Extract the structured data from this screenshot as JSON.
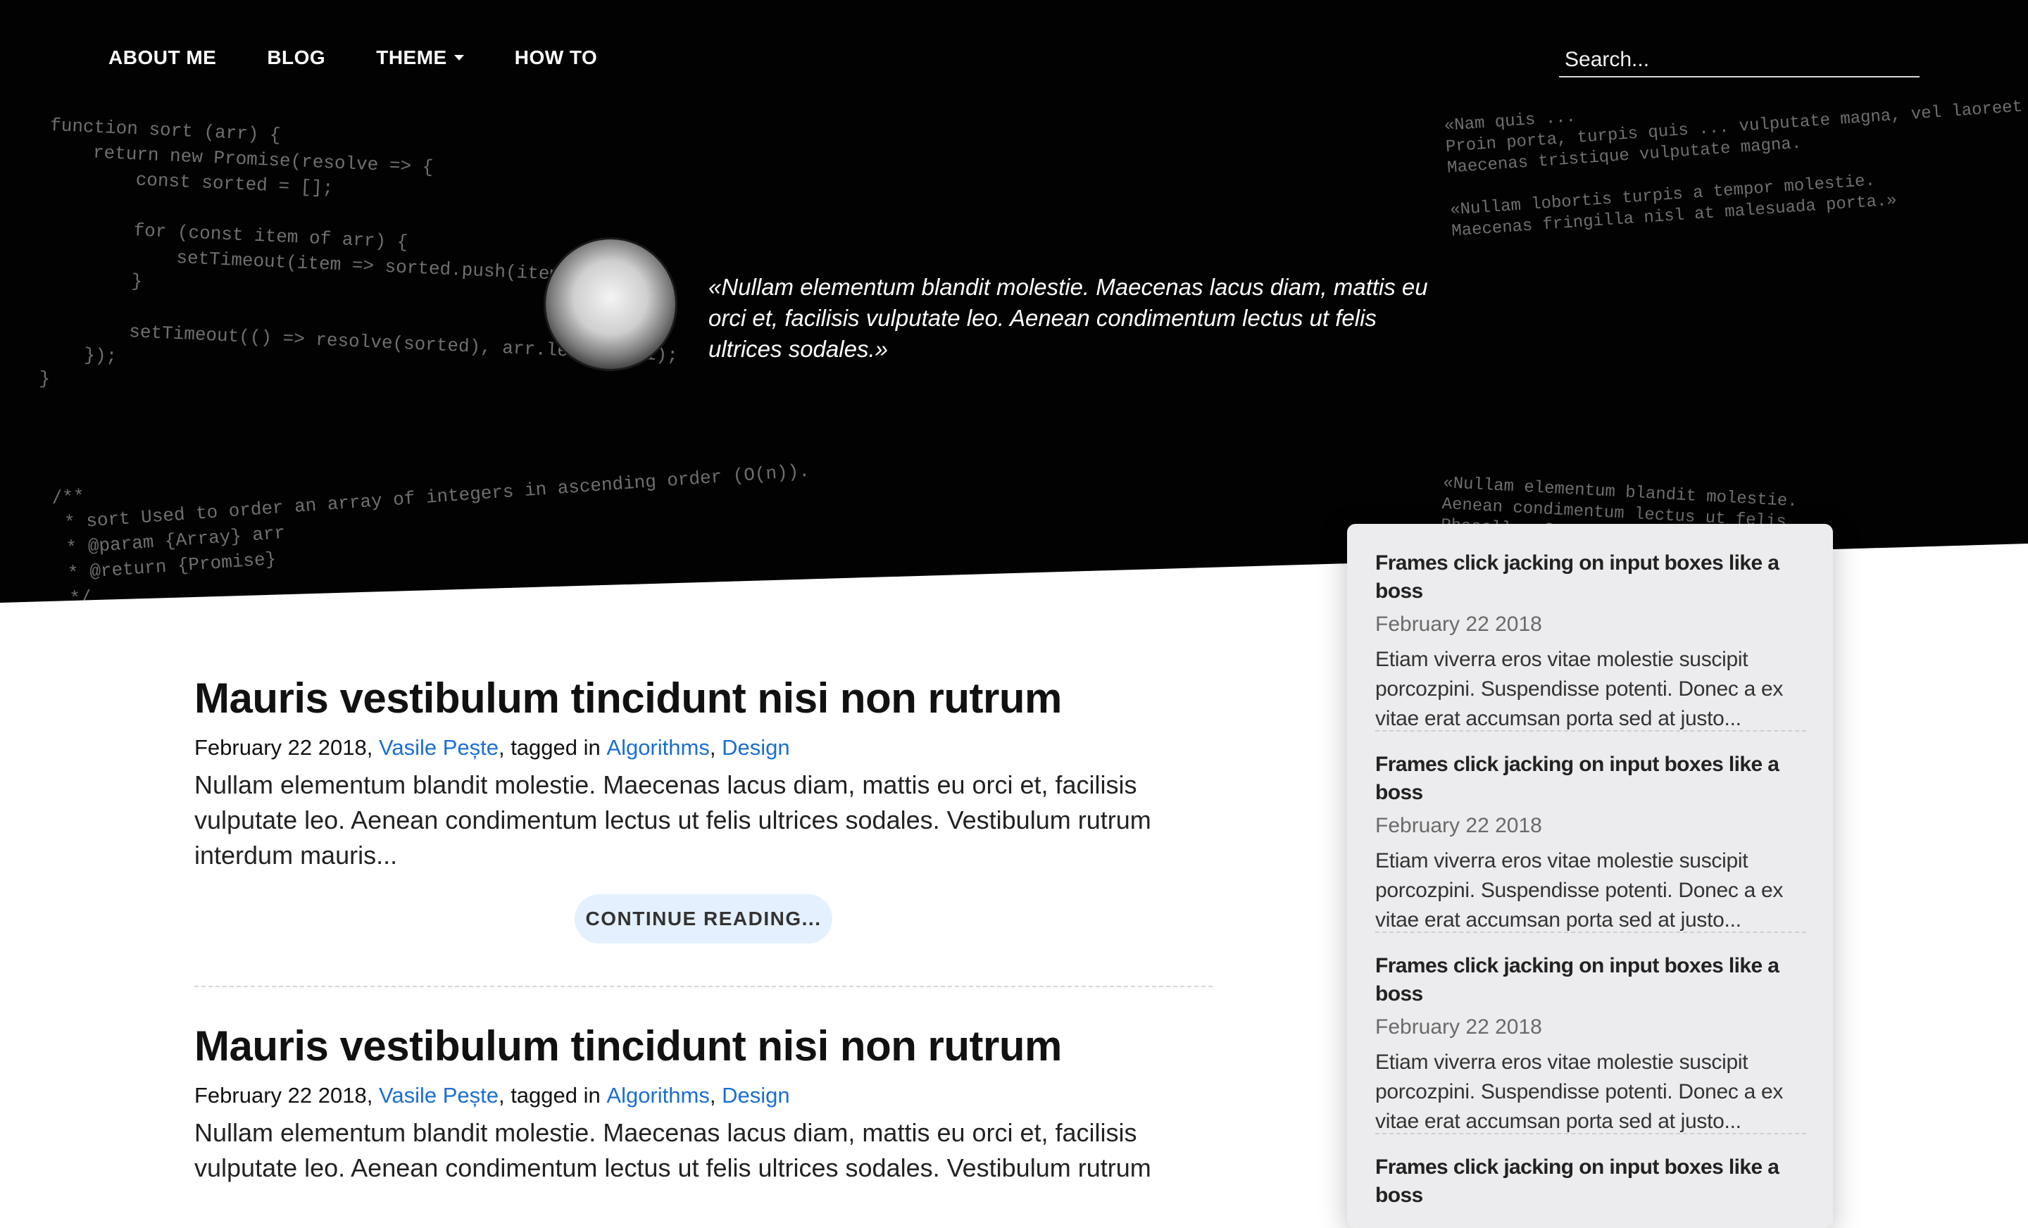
{
  "nav": {
    "items": [
      {
        "label": "ABOUT ME"
      },
      {
        "label": "BLOG"
      },
      {
        "label": "THEME"
      },
      {
        "label": "HOW TO"
      }
    ],
    "search_placeholder": "Search..."
  },
  "hero": {
    "code_left_top": "function sort (arr) {\n    return new Promise(resolve => {\n        const sorted = [];\n\n        for (const item of arr) {\n            setTimeout(item => sorted.push(item), item);\n        }\n\n        setTimeout(() => resolve(sorted), arr.length + 1);\n    });\n}",
    "code_left_bottom": "/**\n * sort Used to order an array of integers in ascending order (O(n)).\n * @param {Array} arr\n * @return {Promise}\n */",
    "code_right_top": "«Nam quis ...\nProin porta, turpis quis ... vulputate magna, vel laoreet\nMaecenas tristique vulputate magna.\n\n«Nullam lobortis turpis a tempor molestie.\nMaecenas fringilla nisl at malesuada porta.»",
    "code_right_bottom": "«Nullam elementum blandit molestie.\nAenean condimentum lectus ut felis\nPhasellus f...",
    "quote": "«Nullam elementum blandit molestie. Maecenas lacus diam, mattis eu orci et, facilisis vulputate leo. Aenean condimentum lectus ut felis ultrices sodales.»"
  },
  "posts": [
    {
      "title": "Mauris vestibulum tincidunt nisi non rutrum",
      "date": "February 22 2018,",
      "author": "Vasile Pește",
      "tagged": ", tagged in",
      "tag1": "Algorithms",
      "comma": ",",
      "tag2": "Design",
      "excerpt": "Nullam elementum blandit molestie. Maecenas lacus diam, mattis eu orci et, facilisis vulputate leo. Aenean condimentum lectus ut felis ultrices sodales. Vestibulum rutrum interdum mauris...",
      "read_more": "CONTINUE READING..."
    },
    {
      "title": "Mauris vestibulum tincidunt nisi non rutrum",
      "date": "February 22 2018,",
      "author": "Vasile Pește",
      "tagged": ", tagged in",
      "tag1": "Algorithms",
      "comma": ",",
      "tag2": "Design",
      "excerpt": "Nullam elementum blandit molestie. Maecenas lacus diam, mattis eu orci et, facilisis vulputate leo. Aenean condimentum lectus ut felis ultrices sodales. Vestibulum rutrum"
    }
  ],
  "sidebar": {
    "items": [
      {
        "title": "Frames click jacking on input boxes like a boss",
        "date": "February 22 2018",
        "text": "Etiam viverra eros vitae molestie suscipit porcozpini. Suspendisse potenti. Donec a ex vitae erat accumsan porta sed at justo..."
      },
      {
        "title": "Frames click jacking on input boxes like a boss",
        "date": "February 22 2018",
        "text": "Etiam viverra eros vitae molestie suscipit porcozpini. Suspendisse potenti. Donec a ex vitae erat accumsan porta sed at justo..."
      },
      {
        "title": "Frames click jacking on input boxes like a boss",
        "date": "February 22 2018",
        "text": "Etiam viverra eros vitae molestie suscipit porcozpini. Suspendisse potenti. Donec a ex vitae erat accumsan porta sed at justo..."
      },
      {
        "title": "Frames click jacking on input boxes like a boss"
      }
    ]
  },
  "colors": {
    "hero_bg": "#020202",
    "link": "#1a6fd0",
    "button_bg": "#e4f0fd",
    "sidebar_bg": "#ececee"
  },
  "icons": {
    "theme_dropdown": "caret-down-icon"
  }
}
